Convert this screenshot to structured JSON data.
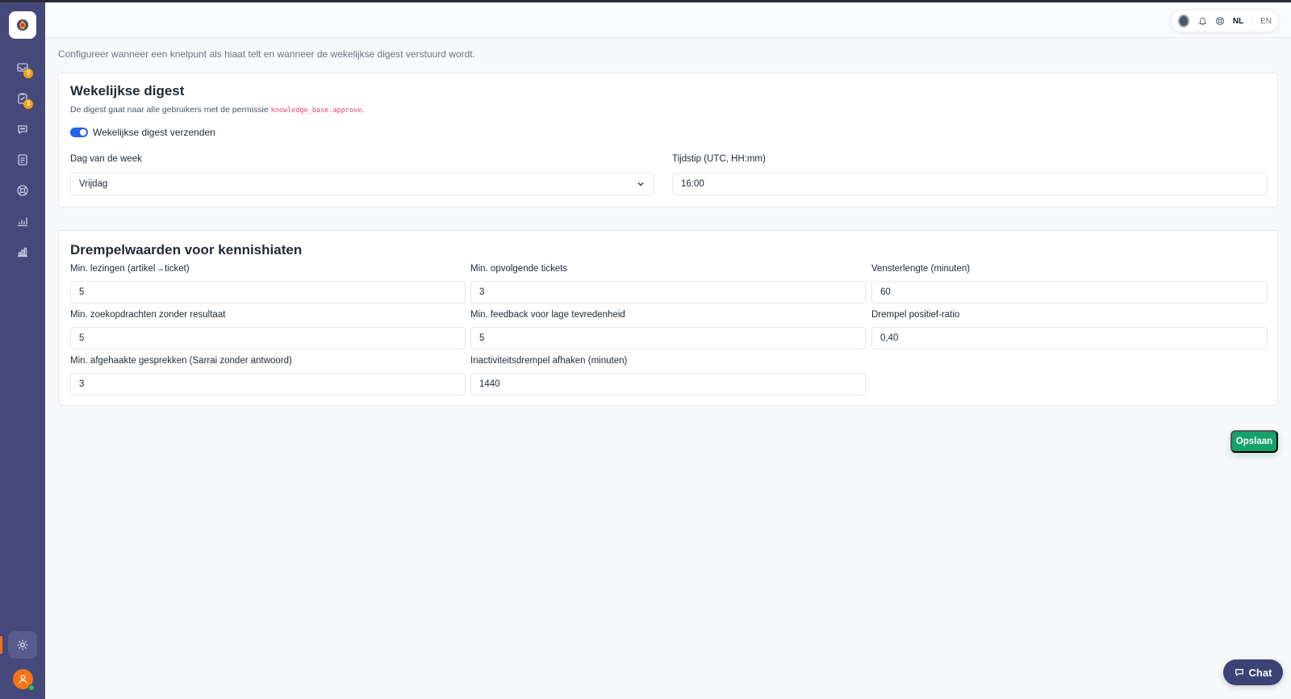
{
  "header": {
    "lang_nl": "NL",
    "lang_en": "EN"
  },
  "sidebar": {
    "items": [
      {
        "icon": "inbox-icon",
        "badge": "3"
      },
      {
        "icon": "clipboard-icon",
        "badge": "3"
      },
      {
        "icon": "chat-bubble-icon",
        "badge": ""
      },
      {
        "icon": "document-icon",
        "badge": ""
      },
      {
        "icon": "lifebuoy-icon",
        "badge": ""
      },
      {
        "icon": "chart-icon",
        "badge": ""
      },
      {
        "icon": "bar-chart-icon",
        "badge": ""
      }
    ],
    "active_accent": "#f97316"
  },
  "intro": "Configureer wanneer een knelpunt als hiaat telt en wanneer de wekelijkse digest verstuurd wordt.",
  "digest": {
    "title": "Wekelijkse digest",
    "desc_prefix": "De digest gaat naar alle gebruikers met de permissie",
    "permission": "knowledge_base.approve",
    "desc_suffix": ".",
    "toggle_label": "Wekelijkse digest verzenden",
    "toggle_on": true,
    "day_label": "Dag van de week",
    "day_value": "Vrijdag",
    "time_label": "Tijdstip (UTC, HH:mm)",
    "time_value": "16:00"
  },
  "thresholds": {
    "title": "Drempelwaarden voor kennishiaten",
    "fields": [
      {
        "label": "Min. lezingen (artikel→ticket)",
        "value": "5"
      },
      {
        "label": "Min. opvolgende tickets",
        "value": "3"
      },
      {
        "label": "Vensterlengte (minuten)",
        "value": "60"
      },
      {
        "label": "Min. zoekopdrachten zonder resultaat",
        "value": "5"
      },
      {
        "label": "Min. feedback voor lage tevredenheid",
        "value": "5"
      },
      {
        "label": "Drempel positief-ratio",
        "value": "0,40"
      },
      {
        "label": "Min. afgehaakte gesprekken (Sarrai zonder antwoord)",
        "value": "3"
      },
      {
        "label": "Inactiviteitsdrempel afhaken (minuten)",
        "value": "1440"
      }
    ]
  },
  "actions": {
    "save": "Opslaan",
    "chat": "Chat"
  },
  "colors": {
    "sidebar": "#45497a",
    "primary_toggle": "#2563eb",
    "save_button": "#16a06a",
    "chat_button": "#3b4276"
  }
}
